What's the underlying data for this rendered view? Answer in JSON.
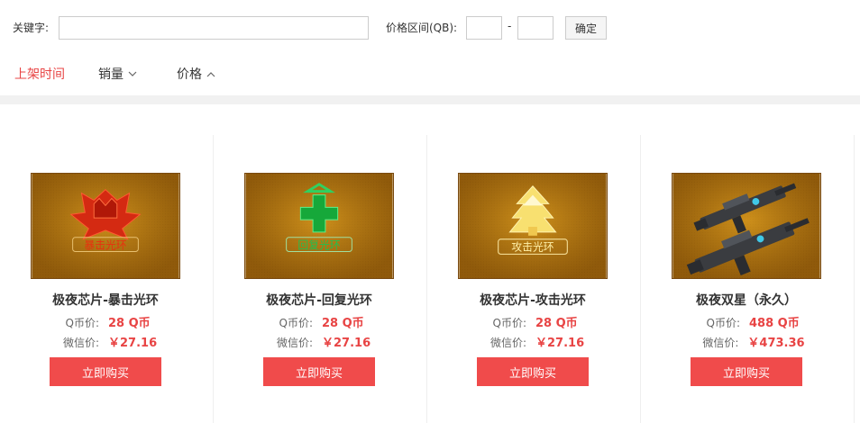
{
  "filter": {
    "keyword_label": "关键字:",
    "keyword_value": "",
    "price_label": "价格区间(QB):",
    "price_min": "",
    "price_max": "",
    "dash": "-",
    "confirm_label": "确定"
  },
  "sort": {
    "items": [
      {
        "label": "上架时间",
        "active": true
      },
      {
        "label": "销量",
        "icon": "chevron-down-icon"
      },
      {
        "label": "价格",
        "icon": "chevron-up-icon"
      }
    ]
  },
  "colors": {
    "accent": "#e84444",
    "buy_button": "#f04b4b",
    "thumb_bg": "#b0730f"
  },
  "products": [
    {
      "name": "极夜芯片-暴击光环",
      "q_label": "Q币价:",
      "q_price": "28 Q币",
      "wx_label": "微信价:",
      "wx_price": "￥27.16",
      "buy_label": "立即购买",
      "thumb_text": "暴击光环",
      "thumb_icon": "crit-aura-emblem"
    },
    {
      "name": "极夜芯片-回复光环",
      "q_label": "Q币价:",
      "q_price": "28 Q币",
      "wx_label": "微信价:",
      "wx_price": "￥27.16",
      "buy_label": "立即购买",
      "thumb_text": "回复光环",
      "thumb_icon": "heal-aura-emblem"
    },
    {
      "name": "极夜芯片-攻击光环",
      "q_label": "Q币价:",
      "q_price": "28 Q币",
      "wx_label": "微信价:",
      "wx_price": "￥27.16",
      "buy_label": "立即购买",
      "thumb_text": "攻击光环",
      "thumb_icon": "attack-aura-emblem"
    },
    {
      "name": "极夜双星（永久）",
      "q_label": "Q币价:",
      "q_price": "488 Q币",
      "wx_label": "微信价:",
      "wx_price": "￥473.36",
      "buy_label": "立即购买",
      "thumb_icon": "twin-guns-image"
    }
  ]
}
